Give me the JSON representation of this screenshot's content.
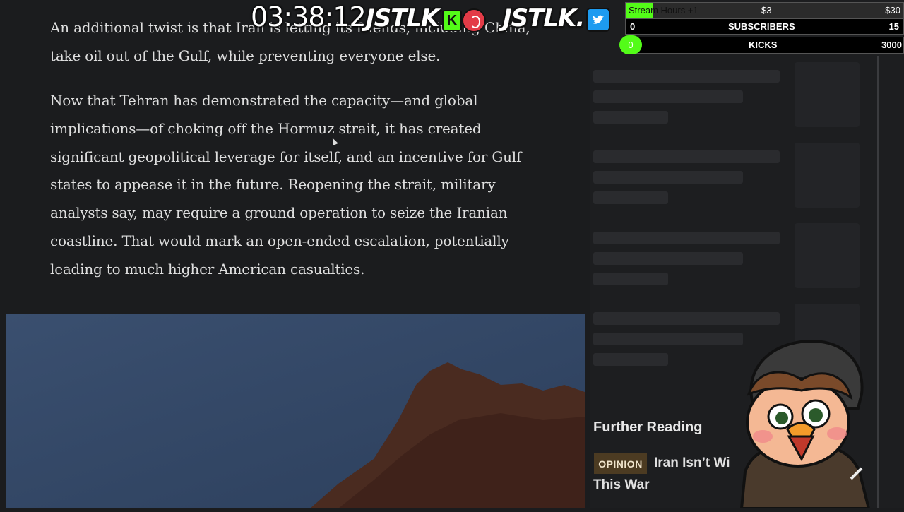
{
  "article": {
    "paragraph1": "An additional twist is that Iran is letting its friends, including China, take oil out of the Gulf, while preventing everyone else.",
    "paragraph2": "Now that Tehran has demonstrated the capacity—and global implications—of choking off the Hormuz strait, it has created significant geopolitical leverage for itself, and an incentive for Gulf states to appease it in the future. Reopening the strait, military analysts say, may require a ground operation to seize the Iranian coastline. That would mark an open-ended escalation, potentially leading to much higher American casualties."
  },
  "sidebar": {
    "further_reading": "Further Reading",
    "badge": "OPINION",
    "title_line1": "Iran Isn’t Wi",
    "title_line2": "This War"
  },
  "overlay": {
    "timer": "03:38:12",
    "logo1": "JSTLK",
    "logo2": "JSTLK.",
    "kick_letter": "K",
    "goal_stream_label": "Stream Hours +1",
    "goal_stream_mid": "$3",
    "goal_stream_max": "$30",
    "goal_stream_progress": 0.1,
    "subs_current": "0",
    "subs_label": "SUBSCRIBERS",
    "subs_target": "15",
    "kicks_current": "0",
    "kicks_label": "KICKS",
    "kicks_target": "3000"
  },
  "colors": {
    "accent_green": "#53fc18",
    "opinion_badge": "#4c3b22",
    "background": "#1b1c1e"
  }
}
